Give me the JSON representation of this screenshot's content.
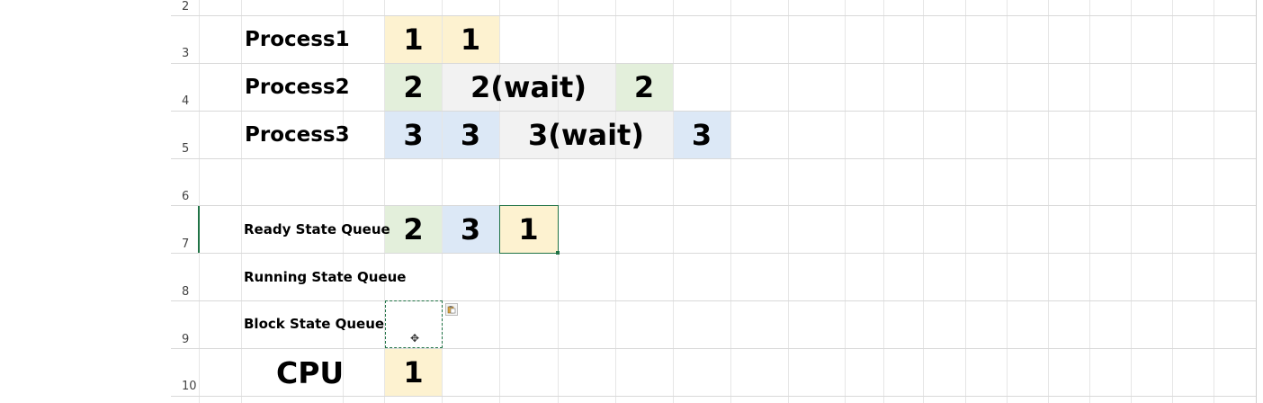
{
  "rows": [
    {
      "num": "2"
    },
    {
      "num": "3"
    },
    {
      "num": "4"
    },
    {
      "num": "5"
    },
    {
      "num": "6"
    },
    {
      "num": "7"
    },
    {
      "num": "8"
    },
    {
      "num": "9"
    },
    {
      "num": "10"
    }
  ],
  "labels": {
    "process1": "Process1",
    "process2": "Process2",
    "process3": "Process3",
    "ready": "Ready State Queue",
    "running": "Running State Queue",
    "block": "Block State Queue",
    "cpu": "CPU"
  },
  "cells": {
    "p1": [
      "1",
      "1"
    ],
    "p2": [
      "2",
      "2(wait)",
      "2"
    ],
    "p3": [
      "3",
      "3",
      "3(wait)",
      "3"
    ],
    "ready": [
      "2",
      "3",
      "1"
    ],
    "cpu": [
      "1"
    ]
  },
  "colors": {
    "process1": "#fdf2d0",
    "process2": "#e3efdb",
    "process3": "#dce8f6",
    "wait": "#f2f2f2",
    "selection": "#217346"
  },
  "icons": {
    "move_cursor": "move-cursor-icon",
    "paste_options": "paste-options-icon"
  }
}
